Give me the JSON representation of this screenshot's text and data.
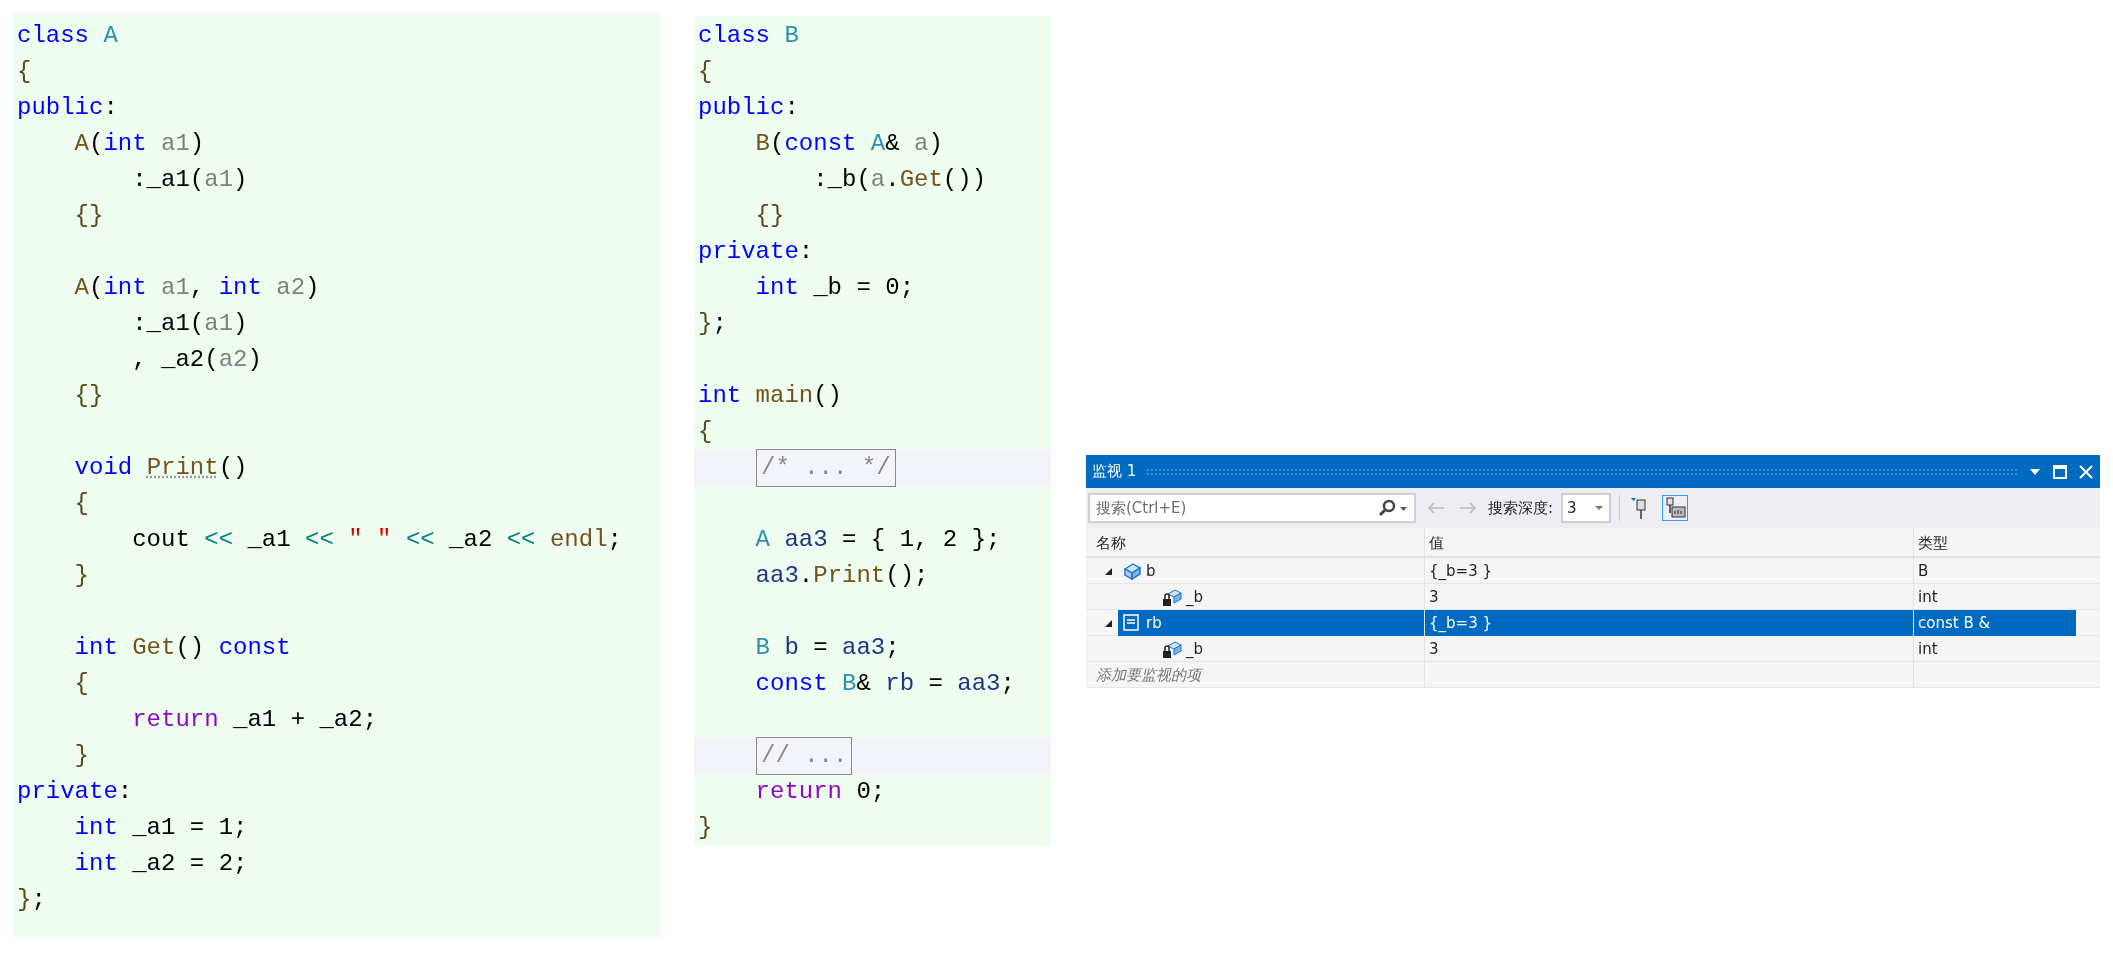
{
  "code_panels": [
    {
      "lines": [
        {
          "kind": "code",
          "tokens": [
            {
              "kind": "kw",
              "text": "class "
            },
            {
              "kind": "type",
              "text": "A"
            }
          ]
        },
        {
          "kind": "code",
          "tokens": [
            {
              "kind": "brace",
              "text": "{"
            }
          ]
        },
        {
          "kind": "code",
          "tokens": [
            {
              "kind": "kw",
              "text": "public"
            },
            {
              "kind": "plain",
              "text": ":"
            }
          ]
        },
        {
          "kind": "code",
          "tokens": [
            {
              "kind": "fn",
              "text": "    A"
            },
            {
              "kind": "plain",
              "text": "("
            },
            {
              "kind": "kw",
              "text": "int "
            },
            {
              "kind": "param",
              "text": "a1"
            },
            {
              "kind": "plain",
              "text": ")"
            }
          ]
        },
        {
          "kind": "code",
          "tokens": [
            {
              "kind": "plain",
              "text": "        :_a1("
            },
            {
              "kind": "param",
              "text": "a1"
            },
            {
              "kind": "plain",
              "text": ")"
            }
          ]
        },
        {
          "kind": "code",
          "tokens": [
            {
              "kind": "brace",
              "text": "    {}"
            }
          ]
        },
        {
          "kind": "blank"
        },
        {
          "kind": "code",
          "tokens": [
            {
              "kind": "fn",
              "text": "    A"
            },
            {
              "kind": "plain",
              "text": "("
            },
            {
              "kind": "kw",
              "text": "int "
            },
            {
              "kind": "param",
              "text": "a1"
            },
            {
              "kind": "plain",
              "text": ", "
            },
            {
              "kind": "kw",
              "text": "int "
            },
            {
              "kind": "param",
              "text": "a2"
            },
            {
              "kind": "plain",
              "text": ")"
            }
          ]
        },
        {
          "kind": "code",
          "tokens": [
            {
              "kind": "plain",
              "text": "        :_a1("
            },
            {
              "kind": "param",
              "text": "a1"
            },
            {
              "kind": "plain",
              "text": ")"
            }
          ]
        },
        {
          "kind": "code",
          "tokens": [
            {
              "kind": "plain",
              "text": "        , _a2("
            },
            {
              "kind": "param",
              "text": "a2"
            },
            {
              "kind": "plain",
              "text": ")"
            }
          ]
        },
        {
          "kind": "code",
          "tokens": [
            {
              "kind": "brace",
              "text": "    {}"
            }
          ]
        },
        {
          "kind": "blank"
        },
        {
          "kind": "code",
          "tokens": [
            {
              "kind": "kw",
              "text": "    void "
            },
            {
              "kind": "hint",
              "text": "Print"
            },
            {
              "kind": "plain",
              "text": "()"
            }
          ]
        },
        {
          "kind": "code",
          "tokens": [
            {
              "kind": "brace",
              "text": "    {"
            }
          ]
        },
        {
          "kind": "code",
          "tokens": [
            {
              "kind": "plain",
              "text": "        cout "
            },
            {
              "kind": "op",
              "text": "<< "
            },
            {
              "kind": "plain",
              "text": "_a1 "
            },
            {
              "kind": "op",
              "text": "<< "
            },
            {
              "kind": "str",
              "text": "\" \" "
            },
            {
              "kind": "op",
              "text": "<< "
            },
            {
              "kind": "plain",
              "text": "_a2 "
            },
            {
              "kind": "op",
              "text": "<< "
            },
            {
              "kind": "fn",
              "text": "endl"
            },
            {
              "kind": "plain",
              "text": ";"
            }
          ]
        },
        {
          "kind": "code",
          "tokens": [
            {
              "kind": "brace",
              "text": "    }"
            }
          ]
        },
        {
          "kind": "blank"
        },
        {
          "kind": "code",
          "tokens": [
            {
              "kind": "kw",
              "text": "    int "
            },
            {
              "kind": "fn",
              "text": "Get"
            },
            {
              "kind": "plain",
              "text": "() "
            },
            {
              "kind": "kw",
              "text": "const"
            }
          ]
        },
        {
          "kind": "code",
          "tokens": [
            {
              "kind": "brace",
              "text": "    {"
            }
          ]
        },
        {
          "kind": "code",
          "tokens": [
            {
              "kind": "ret",
              "text": "        return "
            },
            {
              "kind": "plain",
              "text": "_a1 + _a2;"
            }
          ]
        },
        {
          "kind": "code",
          "tokens": [
            {
              "kind": "brace",
              "text": "    }"
            }
          ]
        },
        {
          "kind": "code",
          "tokens": [
            {
              "kind": "kw",
              "text": "private"
            },
            {
              "kind": "plain",
              "text": ":"
            }
          ]
        },
        {
          "kind": "code",
          "tokens": [
            {
              "kind": "kw",
              "text": "    int "
            },
            {
              "kind": "plain",
              "text": "_a1 = 1;"
            }
          ]
        },
        {
          "kind": "code",
          "tokens": [
            {
              "kind": "kw",
              "text": "    int "
            },
            {
              "kind": "plain",
              "text": "_a2 = 2;"
            }
          ]
        },
        {
          "kind": "code",
          "tokens": [
            {
              "kind": "brace",
              "text": "}"
            },
            {
              "kind": "plain",
              "text": ";"
            }
          ]
        }
      ]
    },
    {
      "lines": [
        {
          "kind": "code",
          "tokens": [
            {
              "kind": "kw",
              "text": "class "
            },
            {
              "kind": "type",
              "text": "B"
            }
          ]
        },
        {
          "kind": "code",
          "tokens": [
            {
              "kind": "brace",
              "text": "{"
            }
          ]
        },
        {
          "kind": "code",
          "tokens": [
            {
              "kind": "kw",
              "text": "public"
            },
            {
              "kind": "plain",
              "text": ":"
            }
          ]
        },
        {
          "kind": "code",
          "tokens": [
            {
              "kind": "fn",
              "text": "    B"
            },
            {
              "kind": "plain",
              "text": "("
            },
            {
              "kind": "kw",
              "text": "const "
            },
            {
              "kind": "type",
              "text": "A"
            },
            {
              "kind": "plain",
              "text": "& "
            },
            {
              "kind": "param",
              "text": "a"
            },
            {
              "kind": "plain",
              "text": ")"
            }
          ]
        },
        {
          "kind": "code",
          "tokens": [
            {
              "kind": "plain",
              "text": "        :_b("
            },
            {
              "kind": "param",
              "text": "a"
            },
            {
              "kind": "plain",
              "text": "."
            },
            {
              "kind": "fn",
              "text": "Get"
            },
            {
              "kind": "plain",
              "text": "())"
            }
          ]
        },
        {
          "kind": "code",
          "tokens": [
            {
              "kind": "brace",
              "text": "    {}"
            }
          ]
        },
        {
          "kind": "code",
          "tokens": [
            {
              "kind": "kw",
              "text": "private"
            },
            {
              "kind": "plain",
              "text": ":"
            }
          ]
        },
        {
          "kind": "code",
          "tokens": [
            {
              "kind": "kw",
              "text": "    int "
            },
            {
              "kind": "plain",
              "text": "_b = 0;"
            }
          ]
        },
        {
          "kind": "code",
          "tokens": [
            {
              "kind": "brace",
              "text": "}"
            },
            {
              "kind": "plain",
              "text": ";"
            }
          ]
        },
        {
          "kind": "blank"
        },
        {
          "kind": "code",
          "tokens": [
            {
              "kind": "kw",
              "text": "int "
            },
            {
              "kind": "fn",
              "text": "main"
            },
            {
              "kind": "plain",
              "text": "()"
            }
          ]
        },
        {
          "kind": "code",
          "tokens": [
            {
              "kind": "brace",
              "text": "{"
            }
          ]
        },
        {
          "kind": "fold",
          "text": "/* ... */"
        },
        {
          "kind": "blank"
        },
        {
          "kind": "code",
          "tokens": [
            {
              "kind": "type",
              "text": "    A "
            },
            {
              "kind": "var",
              "text": "aa3"
            },
            {
              "kind": "plain",
              "text": " = { 1, 2 };"
            }
          ]
        },
        {
          "kind": "code",
          "tokens": [
            {
              "kind": "var",
              "text": "    aa3"
            },
            {
              "kind": "plain",
              "text": "."
            },
            {
              "kind": "fn",
              "text": "Print"
            },
            {
              "kind": "plain",
              "text": "();"
            }
          ]
        },
        {
          "kind": "blank"
        },
        {
          "kind": "code",
          "tokens": [
            {
              "kind": "type",
              "text": "    B "
            },
            {
              "kind": "var",
              "text": "b"
            },
            {
              "kind": "plain",
              "text": " = "
            },
            {
              "kind": "var",
              "text": "aa3"
            },
            {
              "kind": "plain",
              "text": ";"
            }
          ]
        },
        {
          "kind": "code",
          "tokens": [
            {
              "kind": "kw",
              "text": "    const "
            },
            {
              "kind": "type",
              "text": "B"
            },
            {
              "kind": "plain",
              "text": "& "
            },
            {
              "kind": "var",
              "text": "rb"
            },
            {
              "kind": "plain",
              "text": " = "
            },
            {
              "kind": "var",
              "text": "aa3"
            },
            {
              "kind": "plain",
              "text": ";"
            }
          ]
        },
        {
          "kind": "blank"
        },
        {
          "kind": "fold",
          "text": "// ..."
        },
        {
          "kind": "code",
          "tokens": [
            {
              "kind": "ret",
              "text": "    return "
            },
            {
              "kind": "plain",
              "text": "0;"
            }
          ]
        },
        {
          "kind": "code",
          "tokens": [
            {
              "kind": "brace",
              "text": "}"
            }
          ]
        }
      ]
    }
  ],
  "watch_window": {
    "title": "监视 1",
    "toolbar": {
      "search": {
        "placeholder": "搜索(Ctrl+E)"
      },
      "nav_buttons": [
        {
          "kind": "back",
          "disabled": true
        },
        {
          "kind": "forward",
          "disabled": true
        }
      ],
      "depth_label": "搜索深度:",
      "depth_value": "3",
      "pin_buttons": [
        {
          "kind": "pin-filter",
          "selected": false
        },
        {
          "kind": "pin-text",
          "selected": true
        }
      ]
    },
    "columns": [
      "名称",
      "值",
      "类型"
    ],
    "rows": [
      {
        "kind": "object",
        "name": "b",
        "value": "{_b=3 }",
        "type": "B",
        "expanded": true,
        "selected": false,
        "children": [
          {
            "kind": "private_field",
            "name": "_b",
            "value": "3",
            "type": "int",
            "selected": false
          }
        ]
      },
      {
        "kind": "reference",
        "name": "rb",
        "value": "{_b=3 }",
        "type": "const B &",
        "expanded": true,
        "selected": true,
        "children": [
          {
            "kind": "private_field",
            "name": "_b",
            "value": "3",
            "type": "int",
            "selected": false
          }
        ]
      }
    ],
    "add_item_placeholder": "添加要监视的项"
  }
}
